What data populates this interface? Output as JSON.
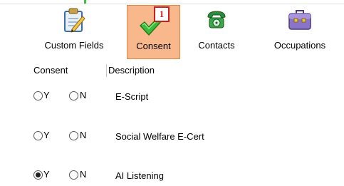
{
  "toolbar": {
    "items": [
      {
        "label": "Custom Fields",
        "icon": "custom-fields-icon",
        "active": false
      },
      {
        "label": "Consent",
        "icon": "checkmark-icon",
        "active": true,
        "badge": "1"
      },
      {
        "label": "Contacts",
        "icon": "telephone-icon",
        "active": false
      },
      {
        "label": "Occupations",
        "icon": "briefcase-icon",
        "active": false
      }
    ],
    "active_color": "#f8b88b",
    "badge_color": "#c81e1e"
  },
  "table": {
    "headers": {
      "consent": "Consent",
      "description": "Description"
    },
    "radio_labels": {
      "yes": "Y",
      "no": "N"
    },
    "rows": [
      {
        "description": "E-Script",
        "selected": null
      },
      {
        "description": "Social Welfare E-Cert",
        "selected": null
      },
      {
        "description": "AI Listening",
        "selected": "Y"
      }
    ]
  }
}
